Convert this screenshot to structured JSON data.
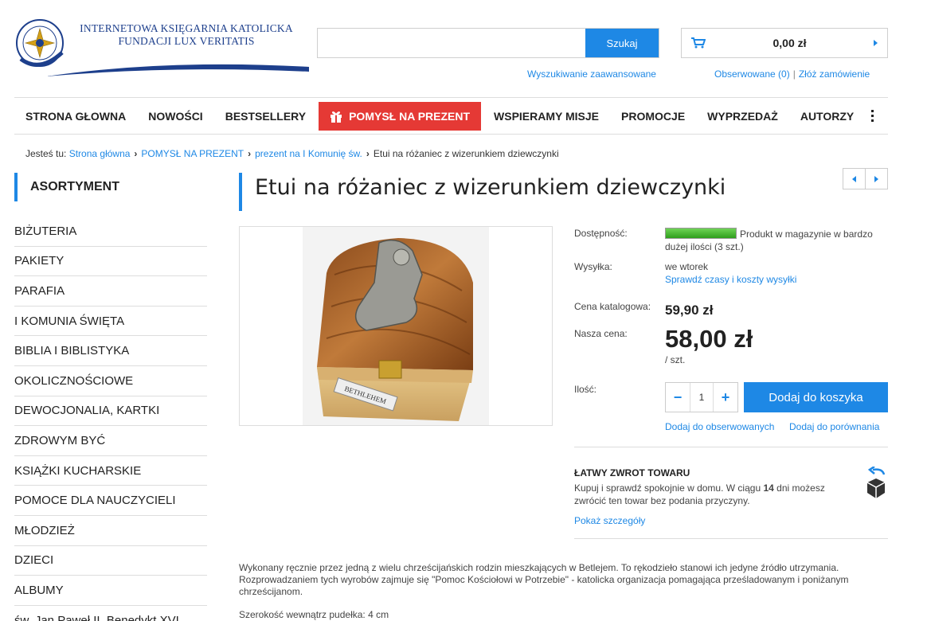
{
  "header": {
    "logo_line1": "INTERNETOWA KSIĘGARNIA KATOLICKA",
    "logo_line2": "FUNDACJI LUX VERITATIS",
    "logo_badge_top": "LUX",
    "logo_badge_bottom": "VERITATIS",
    "search_button": "Szukaj",
    "search_placeholder": "",
    "advanced_search": "Wyszukiwanie zaawansowane",
    "cart_amount": "0,00 zł",
    "watched": "Obserwowane (0)",
    "order": "Złóż zamówienie"
  },
  "nav": {
    "items": [
      "STRONA GŁOWNA",
      "NOWOŚCI",
      "BESTSELLERY",
      "POMYSŁ NA PREZENT",
      "WSPIERAMY MISJE",
      "PROMOCJE",
      "WYPRZEDAŻ",
      "AUTORZY"
    ]
  },
  "breadcrumb": {
    "prefix": "Jesteś tu:",
    "items": [
      "Strona główna",
      "POMYSŁ NA PREZENT",
      "prezent na I Komunię św.",
      "Etui na różaniec z wizerunkiem dziewczynki"
    ]
  },
  "sidebar": {
    "heading": "ASORTYMENT",
    "items": [
      "BIŻUTERIA",
      "PAKIETY",
      "PARAFIA",
      "I KOMUNIA ŚWIĘTA",
      "BIBLIA I BIBLISTYKA",
      "OKOLICZNOŚCIOWE",
      "DEWOCJONALIA, KARTKI",
      "ZDROWYM BYĆ",
      "KSIĄŻKI KUCHARSKIE",
      "POMOCE DLA NAUCZYCIELI",
      "MŁODZIEŻ",
      "DZIECI",
      "ALBUMY",
      "św. Jan Paweł II, Benedykt XVI"
    ]
  },
  "product": {
    "title": "Etui na różaniec z wizerunkiem dziewczynki",
    "image_caption": "BETHLEHEM",
    "availability_label": "Dostępność:",
    "availability_text": "Produkt w magazynie w bardzo dużej ilości (3 szt.)",
    "shipping_label": "Wysyłka:",
    "shipping_value": "we wtorek",
    "shipping_link": "Sprawdź czasy i koszty wysyłki",
    "catalog_price_label": "Cena katalogowa:",
    "catalog_price": "59,90 zł",
    "our_price_label": "Nasza cena:",
    "our_price": "58,00 zł",
    "unit": "/ szt.",
    "qty_label": "Ilość:",
    "qty": "1",
    "add_to_cart": "Dodaj do koszyka",
    "add_watch": "Dodaj do obserwowanych",
    "add_compare": "Dodaj do porównania"
  },
  "returns": {
    "title": "ŁATWY ZWROT TOWARU",
    "text_before": "Kupuj i sprawdź spokojnie w domu. W ciągu ",
    "days": "14",
    "text_after": " dni możesz zwrócić ten towar bez podania przyczyny.",
    "link": "Pokaż szczegóły"
  },
  "description": {
    "p1": "Wykonany ręcznie przez jedną z wielu chrześcijańskich rodzin mieszkających w Betlejem. To rękodzieło stanowi ich jedyne źródło utrzymania. Rozprowadzaniem tych wyrobów zajmuje się \"Pomoc Kościołowi w Potrzebie\" - katolicka organizacja pomagająca prześladowanym i poniżanym chrześcijanom.",
    "p2": "Szerokość wewnątrz pudełka: 4 cm"
  },
  "colors": {
    "accent": "#1e88e5",
    "gift": "#e53935",
    "logo": "#1d3f8c"
  }
}
